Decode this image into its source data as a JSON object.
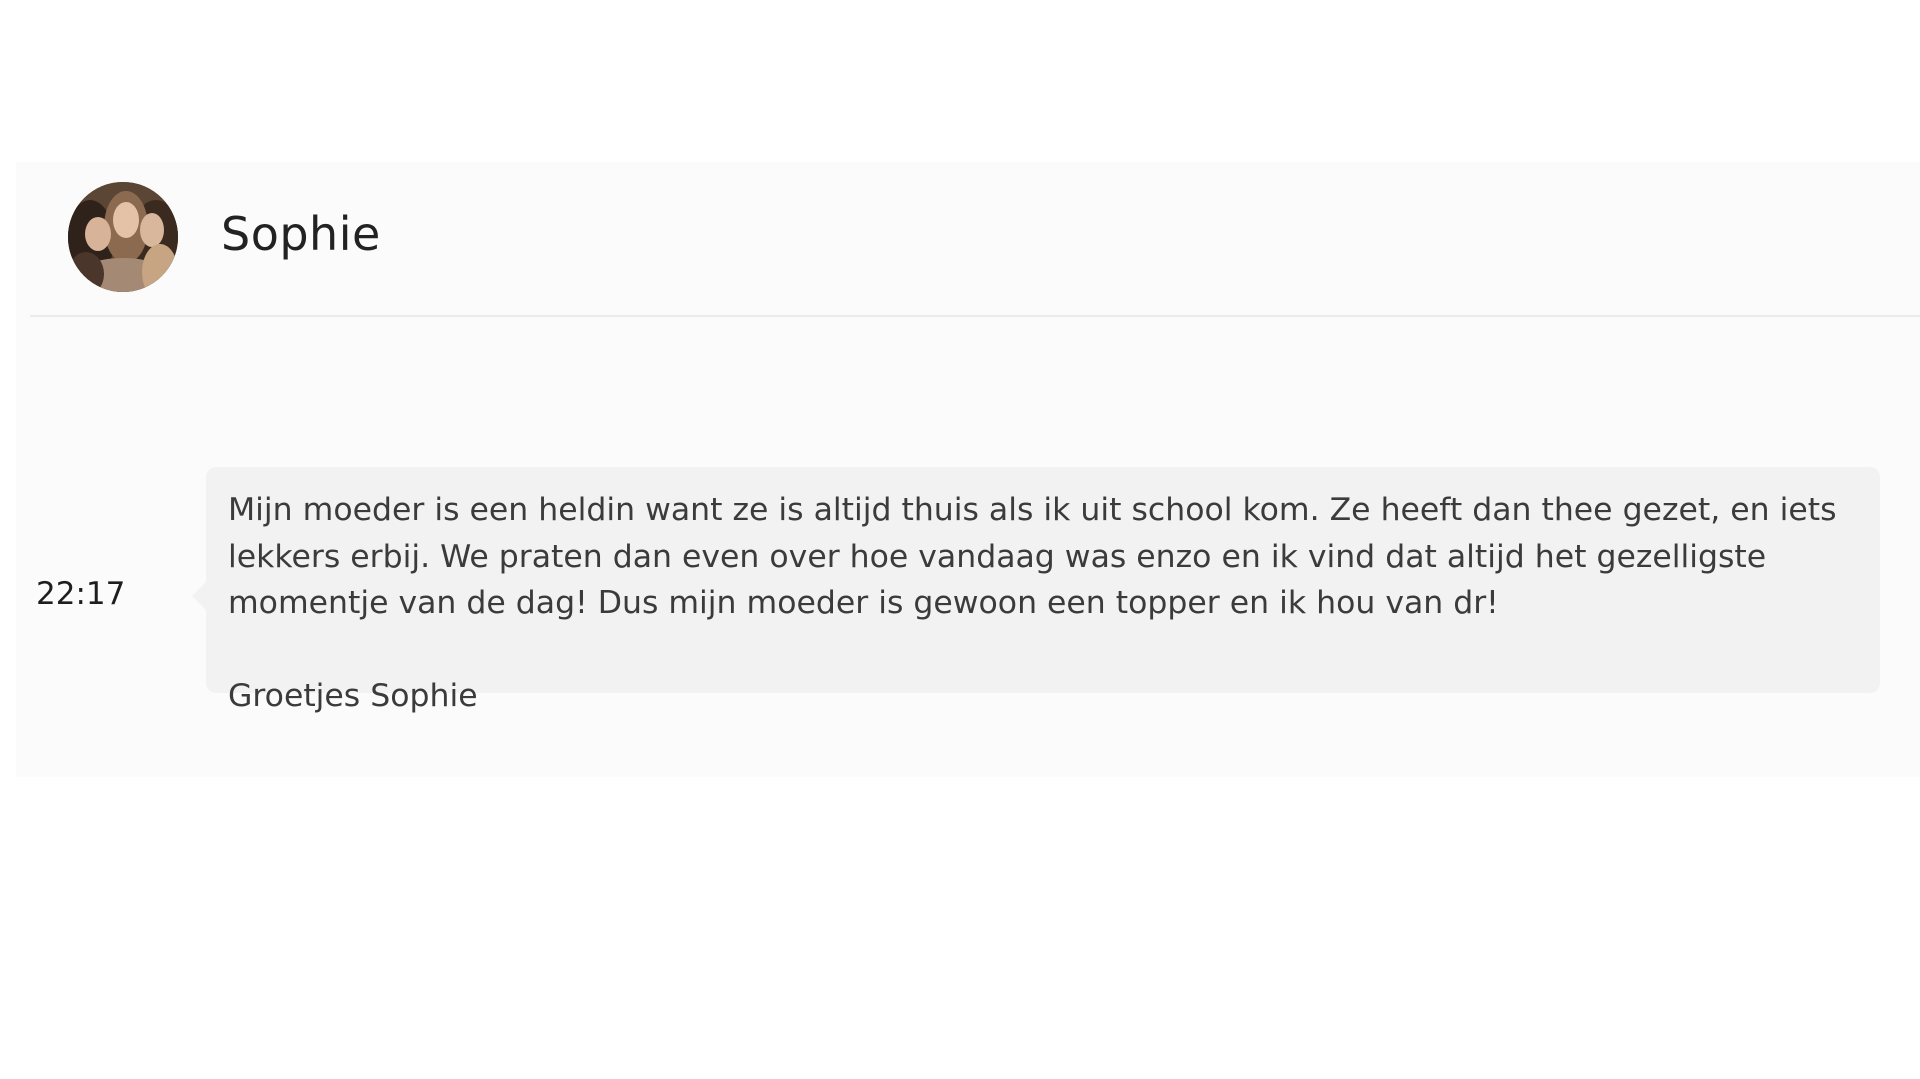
{
  "contact": {
    "name": "Sophie",
    "avatar_icon": "profile-photo"
  },
  "message": {
    "time": "22:17",
    "body": "Mijn moeder is een heldin want ze is altijd thuis als ik uit school kom. Ze heeft dan thee gezet, en iets lekkers erbij. We praten dan even over hoe vandaag was enzo en ik vind dat altijd het gezelligste momentje van de dag! Dus mijn moeder is gewoon een topper en ik hou van dr!",
    "signature": "Groetjes Sophie"
  },
  "colors": {
    "background": "#ffffff",
    "card": "#fbfbfb",
    "bubble": "#f2f2f2",
    "text": "#3b3b3b"
  }
}
